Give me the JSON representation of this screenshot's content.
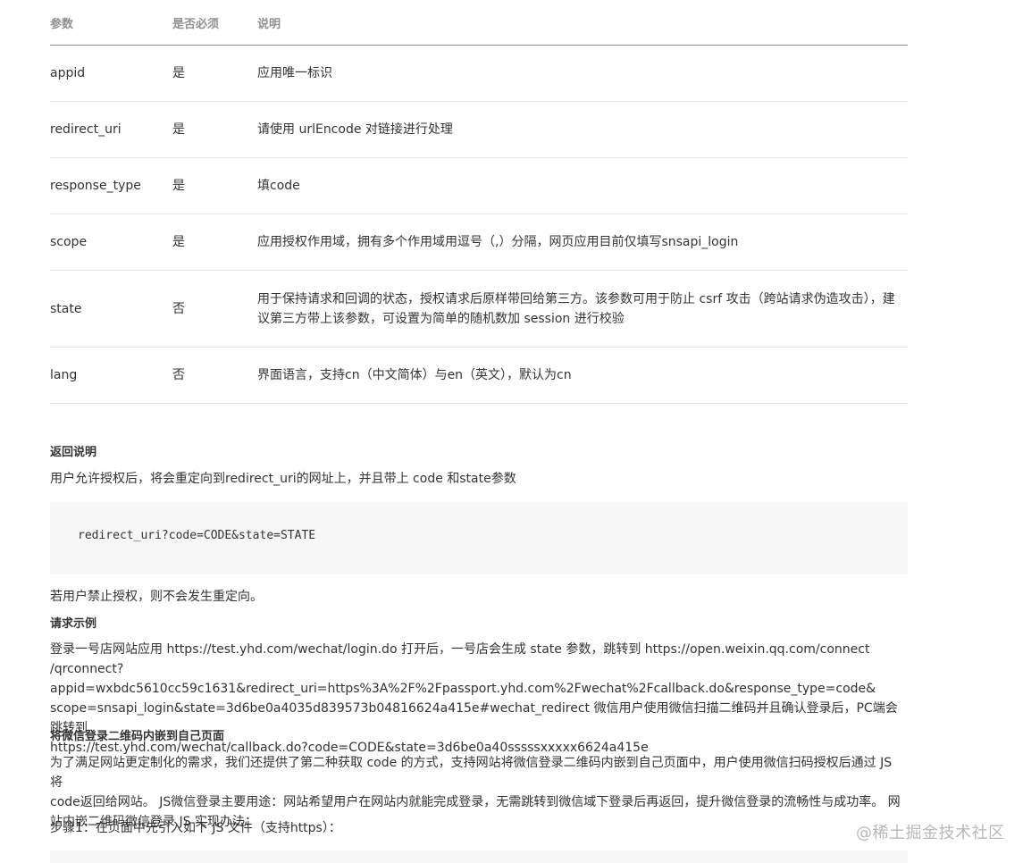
{
  "table": {
    "headers": [
      "参数",
      "是否必须",
      "说明"
    ],
    "rows": [
      {
        "name": "appid",
        "required": "是",
        "desc": "应用唯一标识"
      },
      {
        "name": "redirect_uri",
        "required": "是",
        "desc": "请使用 urlEncode 对链接进行处理"
      },
      {
        "name": "response_type",
        "required": "是",
        "desc": "填code"
      },
      {
        "name": "scope",
        "required": "是",
        "desc": "应用授权作用域，拥有多个作用域用逗号（,）分隔，网页应用目前仅填写snsapi_login"
      },
      {
        "name": "state",
        "required": "否",
        "desc_line1": "用于保持请求和回调的状态，授权请求后原样带回给第三方。该参数可用于防止 csrf 攻击（跨站请求伪造攻击），建",
        "desc_line2": "议第三方带上该参数，可设置为简单的随机数加 session 进行校验"
      },
      {
        "name": "lang",
        "required": "否",
        "desc": "界面语言，支持cn（中文简体）与en（英文），默认为cn"
      }
    ]
  },
  "return_section": {
    "heading": "返回说明",
    "text": "用户允许授权后，将会重定向到redirect_uri的网址上，并且带上 code 和state参数",
    "code": "redirect_uri?code=CODE&state=STATE",
    "after_code": "若用户禁止授权，则不会发生重定向。"
  },
  "example_section": {
    "heading": "请求示例",
    "lines": [
      "登录一号店网站应用 https://test.yhd.com/wechat/login.do 打开后，一号店会生成 state 参数，跳转到 https://open.weixin.qq.com/connect",
      "/qrconnect?appid=wxbdc5610cc59c1631&redirect_uri=https%3A%2F%2Fpassport.yhd.com%2Fwechat%2Fcallback.do&response_type=code&",
      "scope=snsapi_login&state=3d6be0a4035d839573b04816624a415e#wechat_redirect 微信用户使用微信扫描二维码并且确认登录后，PC端会跳转到",
      "https://test.yhd.com/wechat/callback.do?code=CODE&state=3d6be0a40sssssxxxxx6624a415e"
    ]
  },
  "embed_section": {
    "heading": "将微信登录二维码内嵌到自己页面",
    "lines": [
      "为了满足网站更定制化的需求，我们还提供了第二种获取 code 的方式，支持网站将微信登录二维码内嵌到自己页面中，用户使用微信扫码授权后通过 JS 将",
      "code返回给网站。 JS微信登录主要用途：网站希望用户在网站内就能完成登录，无需跳转到微信域下登录后再返回，提升微信登录的流畅性与成功率。 网",
      "站内嵌二维码微信登录 JS 实现办法："
    ],
    "step1": "步骤1：在页面中先引入如下 JS 文件（支持https）："
  },
  "watermark": "@稀土掘金技术社区"
}
